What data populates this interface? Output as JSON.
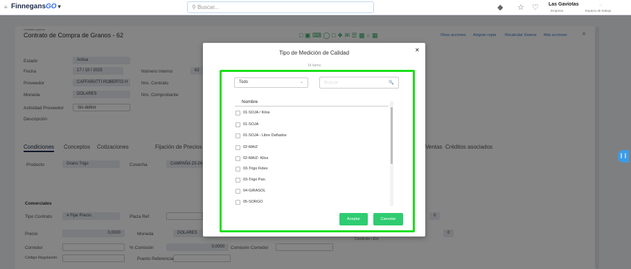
{
  "topbar": {
    "brand": "Finnegans",
    "brand_go": "GO",
    "search_placeholder": "Buscar...",
    "company": "Las Gaviotas",
    "company_sub": "Empresa",
    "role_sub": "Espacio de trabajo"
  },
  "background": {
    "page_sub": "Contratos granos",
    "page_title": "Contrato de Compra de Granos - 62",
    "labels": {
      "estado": "Estado",
      "fecha": "Fecha",
      "proveedor": "Proveedor",
      "moneda": "Moneda",
      "actividad": "Actividad Proveedor",
      "descripcion": "Descripción",
      "numero_interno": "Número Interno",
      "nro_contrato": "Nro. Contrato",
      "nro_comprobante": "Nro. Comprobante",
      "producto": "Producto",
      "cosecha": "Cosecha",
      "comerciales": "Comerciales",
      "tipo_contrato": "Tipo Contrato",
      "precio": "Precio",
      "corredor": "Corredor",
      "codigo": "Código Regulación",
      "plaza_ref": "Plaza Ref",
      "moneda2": "Moneda",
      "pct_comision": "% Comisión",
      "comision_corredor": "Comisión Corredor",
      "puerto": "Puerto Referencia",
      "condicion": "Condición • Ext"
    },
    "values": {
      "estado": "Activa",
      "fecha": "17 / 10 / 2025",
      "numero_interno": "62",
      "proveedor": "CAFFARATTI ROBERTO H",
      "moneda": "DOLARES",
      "actividad": "Sin definir",
      "producto": "Grano Trigo",
      "cosecha": "CAMPAÑA 23-24",
      "tipo_contrato": "A Fijar Precio",
      "precio": "0,0000",
      "moneda2": "DOLARES",
      "pct_comision": "0,0000",
      "val_right1": "0",
      "val_right2": "0"
    },
    "tabs": [
      "Condiciones",
      "Conceptos",
      "Cotizaciones",
      "Fijación de Precios y Cambio",
      "Ventas",
      "Créditos asociados"
    ],
    "toolbar_links": [
      "Otras acciones",
      "Asignar copia",
      "Recalcular Granos",
      "Más acciones"
    ]
  },
  "modal": {
    "title": "Tipo de Medición de Calidad",
    "count": "14 ítems",
    "filter_value": "Todo",
    "search_placeholder": "Buscar",
    "column_header": "Nombre",
    "items": [
      "01-SOJA / Kilos",
      "01-SOJA",
      "01-SOJA - Libre Dañados",
      "02-MAIZ",
      "02-MAIZ- Kilos",
      "03-Trigo Fideo",
      "03-Trigo Pan.",
      "04-GIRASOL",
      "05-SORGO"
    ],
    "accept_label": "Aceptar",
    "cancel_label": "Cancelar"
  },
  "colors": {
    "accent_green": "#2ecc71",
    "highlight_green": "#18e018",
    "brand_navy": "#1d2b4f"
  }
}
